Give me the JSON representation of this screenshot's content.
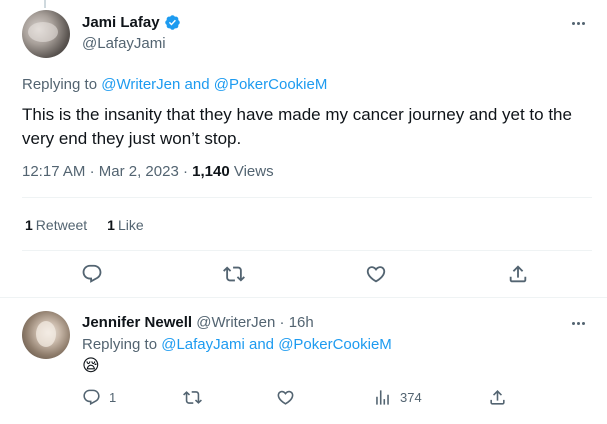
{
  "main_tweet": {
    "display_name": "Jami Lafay",
    "handle": "@LafayJami",
    "replying_prefix": "Replying to",
    "replying_user1": "@WriterJen",
    "replying_and": "and",
    "replying_user2": "@PokerCookieM",
    "text": "This is the insanity that they have made my cancer journey and yet to the very end they just won’t stop.",
    "time": "12:17 AM",
    "sep": "·",
    "date": "Mar 2, 2023",
    "views_count": "1,140",
    "views_label": "Views",
    "retweets_count": "1",
    "retweets_label": "Retweet",
    "likes_count": "1",
    "likes_label": "Like"
  },
  "reply_tweet": {
    "display_name": "Jennifer Newell",
    "handle": "@WriterJen",
    "sep": "·",
    "time_ago": "16h",
    "replying_prefix": "Replying to",
    "replying_user1": "@LafayJami",
    "replying_and": "and",
    "replying_user2": "@PokerCookieM",
    "emoji": "😪",
    "reply_count": "1",
    "views_count": "374"
  },
  "colors": {
    "link": "#1d9bf0",
    "secondary_text": "#536471",
    "primary_text": "#0f1419",
    "verified": "#1d9bf0",
    "divider": "#eff3f4"
  },
  "icons": {
    "more": "more-icon",
    "verified": "verified-badge-icon",
    "reply": "reply-icon",
    "retweet": "retweet-icon",
    "like": "like-icon",
    "share": "share-icon",
    "views": "views-icon"
  }
}
